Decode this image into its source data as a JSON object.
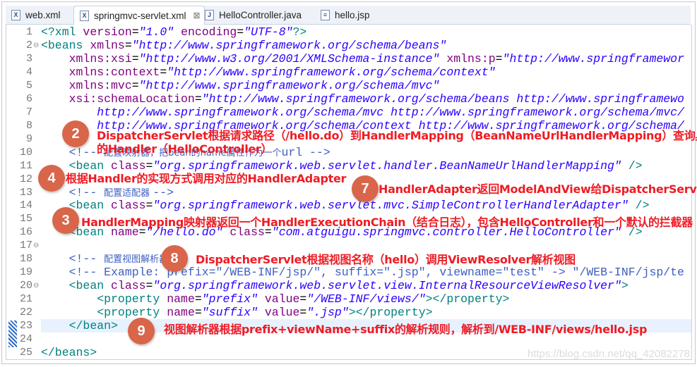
{
  "tabs": [
    {
      "label": "web.xml",
      "icon": "xml-file-icon",
      "glyph": "X"
    },
    {
      "label": "springmvc-servlet.xml",
      "icon": "xml-file-icon",
      "glyph": "X",
      "active": true,
      "close": "⊠"
    },
    {
      "label": "HelloController.java",
      "icon": "java-file-icon",
      "glyph": "J"
    },
    {
      "label": "hello.jsp",
      "icon": "jsp-file-icon",
      "glyph": "≡"
    }
  ],
  "colors": {
    "tag": "#008080",
    "attr": "#7f007f",
    "value": "#2a00ff",
    "comment": "#3f5fbf",
    "badge": "#d9654a",
    "note": "#ee1c25",
    "highlight": "#e8f2fe"
  },
  "lines": [
    {
      "n": "1",
      "tokens": [
        [
          "tag",
          "<?xml "
        ],
        [
          "attr",
          "version"
        ],
        [
          "txt",
          "="
        ],
        [
          "val",
          "\"1.0\""
        ],
        [
          "txt",
          " "
        ],
        [
          "attr",
          "encoding"
        ],
        [
          "txt",
          "="
        ],
        [
          "val",
          "\"UTF-8\""
        ],
        [
          "tag",
          "?>"
        ]
      ]
    },
    {
      "n": "2",
      "fold": true,
      "tokens": [
        [
          "tag",
          "<beans "
        ],
        [
          "attr",
          "xmlns"
        ],
        [
          "txt",
          "="
        ],
        [
          "val",
          "\"http://www.springframework.org/schema/beans\""
        ]
      ]
    },
    {
      "n": "3",
      "tokens": [
        [
          "txt",
          "    "
        ],
        [
          "attr",
          "xmlns:xsi"
        ],
        [
          "txt",
          "="
        ],
        [
          "val",
          "\"http://www.w3.org/2001/XMLSchema-instance\""
        ],
        [
          "txt",
          " "
        ],
        [
          "attr",
          "xmlns:p"
        ],
        [
          "txt",
          "="
        ],
        [
          "val",
          "\"http://www.springframewor"
        ]
      ]
    },
    {
      "n": "4",
      "tokens": [
        [
          "txt",
          "    "
        ],
        [
          "attr",
          "xmlns:context"
        ],
        [
          "txt",
          "="
        ],
        [
          "val",
          "\"http://www.springframework.org/schema/context\""
        ]
      ]
    },
    {
      "n": "5",
      "tokens": [
        [
          "txt",
          "    "
        ],
        [
          "attr",
          "xmlns:mvc"
        ],
        [
          "txt",
          "="
        ],
        [
          "val",
          "\"http://www.springframework.org/schema/mvc\""
        ]
      ]
    },
    {
      "n": "6",
      "tokens": [
        [
          "txt",
          "    "
        ],
        [
          "attr",
          "xsi:schemaLocation"
        ],
        [
          "txt",
          "="
        ],
        [
          "val",
          "\"http://www.springframework.org/schema/beans http://www.springframewo"
        ]
      ]
    },
    {
      "n": "7",
      "tokens": [
        [
          "txt",
          "        "
        ],
        [
          "val",
          "http://www.springframework.org/schema/mvc http://www.springframework.org/schema/mvc/"
        ]
      ]
    },
    {
      "n": "8",
      "tokens": [
        [
          "txt",
          "        "
        ],
        [
          "val",
          "http://www.springframework.org/schema/context http://www.springframework.org/schema/"
        ]
      ]
    },
    {
      "n": "9",
      "tokens": []
    },
    {
      "n": "10",
      "tokens": [
        [
          "txt",
          "    "
        ],
        [
          "com",
          "<!-- "
        ],
        [
          "cjk",
          "配置映射器，把bean的name属性作为一个"
        ],
        [
          "com",
          "url -->"
        ]
      ]
    },
    {
      "n": "11",
      "tokens": [
        [
          "txt",
          "    "
        ],
        [
          "tag",
          "<bean "
        ],
        [
          "attr",
          "class"
        ],
        [
          "txt",
          "="
        ],
        [
          "val",
          "\"org.springframework.web.servlet.handler.BeanNameUrlHandlerMapping\""
        ],
        [
          "tag",
          " />"
        ]
      ]
    },
    {
      "n": "12",
      "tokens": []
    },
    {
      "n": "13",
      "tokens": [
        [
          "txt",
          "    "
        ],
        [
          "com",
          "<!-- "
        ],
        [
          "cjk",
          "配置适配器 "
        ],
        [
          "com",
          "-->"
        ]
      ]
    },
    {
      "n": "14",
      "tokens": [
        [
          "txt",
          "    "
        ],
        [
          "tag",
          "<bean "
        ],
        [
          "attr",
          "class"
        ],
        [
          "txt",
          "="
        ],
        [
          "val",
          "\"org.springframework.web.servlet.mvc.SimpleControllerHandlerAdapter\""
        ],
        [
          "tag",
          " />"
        ]
      ]
    },
    {
      "n": "15",
      "tokens": []
    },
    {
      "n": "16",
      "tokens": [
        [
          "txt",
          "    "
        ],
        [
          "tag",
          "<bean "
        ],
        [
          "attr",
          "name"
        ],
        [
          "txt",
          "="
        ],
        [
          "val",
          "\"/hello.do\""
        ],
        [
          "txt",
          " "
        ],
        [
          "attr",
          "class"
        ],
        [
          "txt",
          "="
        ],
        [
          "val",
          "\"com.atguigu.springmvc.controller.HelloController\""
        ],
        [
          "tag",
          " />"
        ]
      ]
    },
    {
      "n": "17",
      "fold": true,
      "tokens": []
    },
    {
      "n": "18",
      "tokens": [
        [
          "txt",
          "    "
        ],
        [
          "com",
          "<!-- "
        ],
        [
          "cjk",
          "配置视图解析器"
        ]
      ]
    },
    {
      "n": "19",
      "tokens": [
        [
          "txt",
          "    "
        ],
        [
          "com",
          "<!-- Example: prefix=\"/WEB-INF/jsp/\", suffix=\".jsp\", viewname=\"test\" -> \"/WEB-INF/jsp/te"
        ]
      ]
    },
    {
      "n": "20",
      "fold": true,
      "tokens": [
        [
          "txt",
          "    "
        ],
        [
          "tag",
          "<bean "
        ],
        [
          "attr",
          "class"
        ],
        [
          "txt",
          "="
        ],
        [
          "val",
          "\"org.springframework.web.servlet.view.InternalResourceViewResolver\""
        ],
        [
          "tag",
          ">"
        ]
      ]
    },
    {
      "n": "21",
      "tokens": [
        [
          "txt",
          "        "
        ],
        [
          "tag",
          "<property "
        ],
        [
          "attr",
          "name"
        ],
        [
          "txt",
          "="
        ],
        [
          "val",
          "\"prefix\""
        ],
        [
          "txt",
          " "
        ],
        [
          "attr",
          "value"
        ],
        [
          "txt",
          "="
        ],
        [
          "val",
          "\"/WEB-INF/views/\""
        ],
        [
          "tag",
          "></property>"
        ]
      ]
    },
    {
      "n": "22",
      "tokens": [
        [
          "txt",
          "        "
        ],
        [
          "tag",
          "<property "
        ],
        [
          "attr",
          "name"
        ],
        [
          "txt",
          "="
        ],
        [
          "val",
          "\"suffix\""
        ],
        [
          "txt",
          " "
        ],
        [
          "attr",
          "value"
        ],
        [
          "txt",
          "="
        ],
        [
          "val",
          "\".jsp\""
        ],
        [
          "tag",
          "></property>"
        ]
      ]
    },
    {
      "n": "23",
      "highlight": true,
      "tokens": [
        [
          "txt",
          "    "
        ],
        [
          "tag",
          "</bean>"
        ]
      ]
    },
    {
      "n": "24",
      "tokens": []
    },
    {
      "n": "25",
      "tokens": [
        [
          "tag",
          "</beans>"
        ]
      ]
    }
  ],
  "annotations": [
    {
      "step": "2",
      "lines": [
        "DispatcherServlet根据请求路径（/hello.do）到HandlerMapping（BeanNameUrlHandlerMapping）查询具体",
        "的Handler（HelloController）"
      ]
    },
    {
      "step": "4",
      "lines": [
        "根据Handler的实现方式调用对应的HandlerAdapter"
      ]
    },
    {
      "step": "7",
      "lines": [
        "HandlerAdapter返回ModelAndView给DispatcherServlet"
      ]
    },
    {
      "step": "3",
      "lines": [
        "HandlerMapping映射器返回一个HandlerExecutionChain（结合日志），包含HelloController和一个默认的拦截器"
      ]
    },
    {
      "step": "8",
      "lines": [
        "DispatcherServlet根据视图名称（hello）调用ViewResolver解析视图"
      ]
    },
    {
      "step": "9",
      "lines": [
        "视图解析器根据prefix+viewName+suffix的解析规则，解析到/WEB-INF/views/hello.jsp"
      ]
    }
  ],
  "watermark": "https://blog.csdn.net/qq_42082278"
}
